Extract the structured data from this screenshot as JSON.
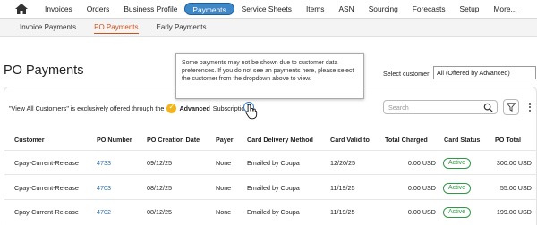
{
  "nav": {
    "items": [
      "Invoices",
      "Orders",
      "Business Profile",
      "Payments",
      "Service Sheets",
      "Items",
      "ASN",
      "Sourcing",
      "Forecasts",
      "Setup",
      "More..."
    ],
    "active_index": 3
  },
  "subnav": {
    "items": [
      "Invoice Payments",
      "PO Payments",
      "Early Payments"
    ],
    "active_index": 1
  },
  "page": {
    "title": "PO Payments"
  },
  "tooltip": {
    "text": "Some payments may not be shown due to customer data preferences. If you do not see an payments here, please select the customer from the dropdown above to view."
  },
  "customer_select": {
    "label": "Select customer",
    "value": "All (Offered by Advanced)"
  },
  "notice": {
    "prefix": "\"View All Customers\" is exclusively offered through the",
    "advanced": "Advanced",
    "suffix": "Subscription"
  },
  "search": {
    "placeholder": "Search"
  },
  "table": {
    "columns": [
      "Customer",
      "PO Number",
      "PO Creation Date",
      "Payer",
      "Card Delivery Method",
      "Card Valid to",
      "Total Charged",
      "Card Status",
      "PO Total"
    ],
    "rows": [
      [
        "Cpay-Current-Release",
        "4733",
        "09/12/25",
        "None",
        "Emailed by Coupa",
        "12/20/25",
        "0.00 USD",
        "Active",
        "300.00 USD"
      ],
      [
        "Cpay-Current-Release",
        "4703",
        "08/12/25",
        "None",
        "Emailed by Coupa",
        "11/19/25",
        "0.00 USD",
        "Active",
        "55.00 USD"
      ],
      [
        "Cpay-Current-Release",
        "4702",
        "08/12/25",
        "None",
        "Emailed by Coupa",
        "11/19/25",
        "0.00 USD",
        "Active",
        "199.00 USD"
      ]
    ]
  },
  "colors": {
    "nav_active": "#3f88c8",
    "subnav_active": "#c9531d",
    "link": "#2a6fb3",
    "status_active": "#2f9a44",
    "badge": "#f2b41d"
  },
  "icons": [
    "home-icon",
    "help-icon",
    "search-icon",
    "filter-icon",
    "more-vertical-icon",
    "pointer-cursor-icon",
    "advanced-badge-icon"
  ]
}
